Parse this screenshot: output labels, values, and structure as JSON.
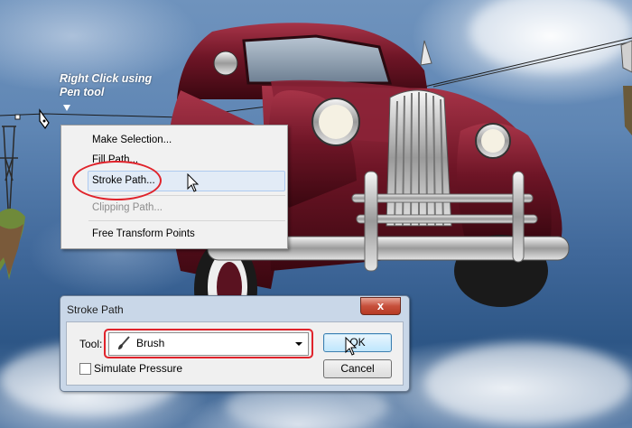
{
  "annotation": {
    "line1": "Right Click using",
    "line2": "Pen tool"
  },
  "context_menu": {
    "items": [
      {
        "label": "Make Selection...",
        "enabled": true
      },
      {
        "label": "Fill Path...",
        "enabled": true
      },
      {
        "label": "Stroke Path...",
        "enabled": true,
        "highlighted": true
      },
      {
        "label": "Clipping Path...",
        "enabled": false
      },
      {
        "label": "Free Transform Points",
        "enabled": true
      }
    ]
  },
  "dialog": {
    "title": "Stroke Path",
    "close_label": "x",
    "tool_label": "Tool:",
    "tool_value": "Brush",
    "tool_icon": "brush-icon",
    "simulate_pressure_label": "Simulate Pressure",
    "simulate_pressure_checked": false,
    "ok_label": "OK",
    "cancel_label": "Cancel"
  },
  "colors": {
    "highlight_circle": "#e0232b",
    "menu_hover": "#e2ebf6",
    "dialog_frame": "#c9d7e8",
    "car_body": "#6e1526"
  }
}
